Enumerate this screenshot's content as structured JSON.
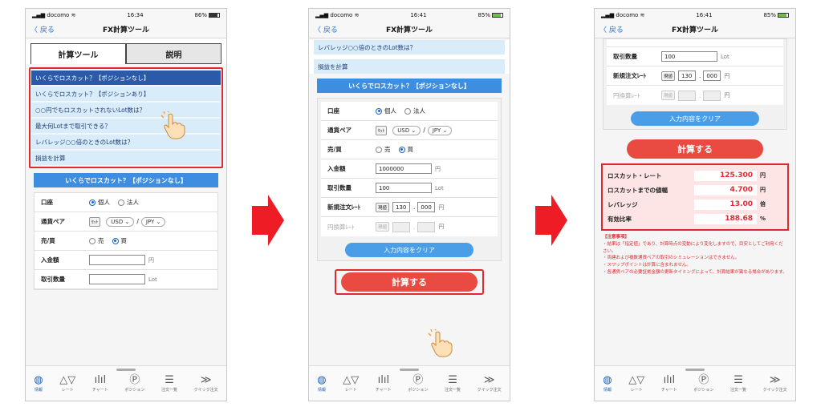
{
  "app": {
    "title": "FX計算ツール",
    "back_label": "戻る"
  },
  "status": {
    "s1": {
      "carrier": "docomo",
      "time": "16:34",
      "battery": "86%",
      "battery_fill": 0.86
    },
    "s2": {
      "carrier": "docomo",
      "time": "16:41",
      "battery": "85%",
      "battery_fill": 0.85
    },
    "s3": {
      "carrier": "docomo",
      "time": "16:41",
      "battery": "85%",
      "battery_fill": 0.85
    }
  },
  "tabs": {
    "calc": "計算ツール",
    "explain": "説明"
  },
  "menu": {
    "items": [
      "いくらでロスカット？【ポジションなし】",
      "いくらでロスカット？【ポジションあり】",
      "○○円でもロスカットされないLot数は？",
      "最大何Lotまで取引できる？",
      "レバレッジ○○倍のときのLot数は？",
      "損益を計算"
    ]
  },
  "section_title": "いくらでロスカット？【ポジションなし】",
  "form": {
    "account_label": "口座",
    "account_personal": "個人",
    "account_corp": "法人",
    "pair_label": "通貨ペア",
    "pair_set": "ｾｯﾄ",
    "pair_base": "USD",
    "pair_quote": "JPY",
    "pair_sep": "/",
    "side_label": "売/買",
    "side_sell": "売",
    "side_buy": "買",
    "deposit_label": "入金額",
    "deposit_value": "1000000",
    "deposit_unit": "円",
    "lot_label": "取引数量",
    "lot_value": "100",
    "lot_unit": "Lot",
    "rate_label": "新規注文ﾚｰﾄ",
    "rate_btn": "現値",
    "rate_int": "130",
    "rate_dec": "000",
    "rate_dot": ".",
    "rate_unit": "円",
    "conv_label": "円換算ﾚｰﾄ",
    "conv_btn": "現値",
    "conv_unit": "円",
    "clear_button": "入力内容をクリア",
    "calc_button": "計算する"
  },
  "results": [
    {
      "label": "ロスカット・レート",
      "value": "125.300",
      "unit": "円"
    },
    {
      "label": "ロスカットまでの値幅",
      "value": "4.700",
      "unit": "円"
    },
    {
      "label": "レバレッジ",
      "value": "13.00",
      "unit": "倍"
    },
    {
      "label": "有効比率",
      "value": "188.68",
      "unit": "%"
    }
  ],
  "notes": {
    "heading": "【注意事項】",
    "lines": [
      "・結果は「指定値」であり、計算時点の変動により変化しますので、目安としてご利用ください。",
      "・両建および複数通貨ペアの取引のシミュレーションはできません。",
      "・スワップポイントは計算に含まれません。",
      "・各通貨ペアの必要証拠金額の更新タイミングによって、計算結果が異なる場合があります。"
    ]
  },
  "bottom_nav": [
    {
      "icon": "globe-icon",
      "label": "情報"
    },
    {
      "icon": "rate-icon",
      "label": "レート"
    },
    {
      "icon": "chart-icon",
      "label": "チャート"
    },
    {
      "icon": "position-icon",
      "label": "ポジション"
    },
    {
      "icon": "list-icon",
      "label": "注文一覧"
    },
    {
      "icon": "quick-icon",
      "label": "クイック注文"
    }
  ],
  "colors": {
    "accent_red": "#e0292e",
    "accent_blue": "#3d8ee0",
    "menu_bg": "#d9ecf9"
  }
}
